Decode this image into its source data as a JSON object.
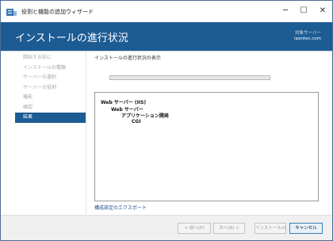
{
  "window": {
    "title": "役割と機能の追加ウィザード",
    "controls": {
      "minimize": "─",
      "maximize": "☐",
      "close": "✕"
    }
  },
  "header": {
    "title": "インストールの進行状況",
    "target_label": "対象サーバー",
    "target_host": "ipentec.com",
    "bg_color": "#1d5b93"
  },
  "sidebar": {
    "items": [
      {
        "label": "開始する前に",
        "active": false
      },
      {
        "label": "インストールの種類",
        "active": false
      },
      {
        "label": "サーバーの選択",
        "active": false
      },
      {
        "label": "サーバーの役割",
        "active": false
      },
      {
        "label": "機能",
        "active": false
      },
      {
        "label": "確認",
        "active": false
      },
      {
        "label": "結果",
        "active": true
      }
    ]
  },
  "main": {
    "section_label": "インストールの進行状況の表示",
    "progress_fraction": 0.0,
    "results": [
      {
        "label": "Web サーバー (IIS)",
        "level": 0
      },
      {
        "label": "Web サーバー",
        "level": 1
      },
      {
        "label": "アプリケーション開発",
        "level": 2
      },
      {
        "label": "CGI",
        "level": 3
      }
    ],
    "export_link": "構成設定のエクスポート"
  },
  "footer": {
    "prev_label": "< 前へ(P)",
    "next_label": "次へ(N) >",
    "install_label": "インストール(I)",
    "cancel_label": "キャンセル"
  },
  "icons": {
    "app": "server-manager-icon",
    "minimize": "minimize-icon",
    "maximize": "maximize-icon",
    "close": "close-icon"
  }
}
